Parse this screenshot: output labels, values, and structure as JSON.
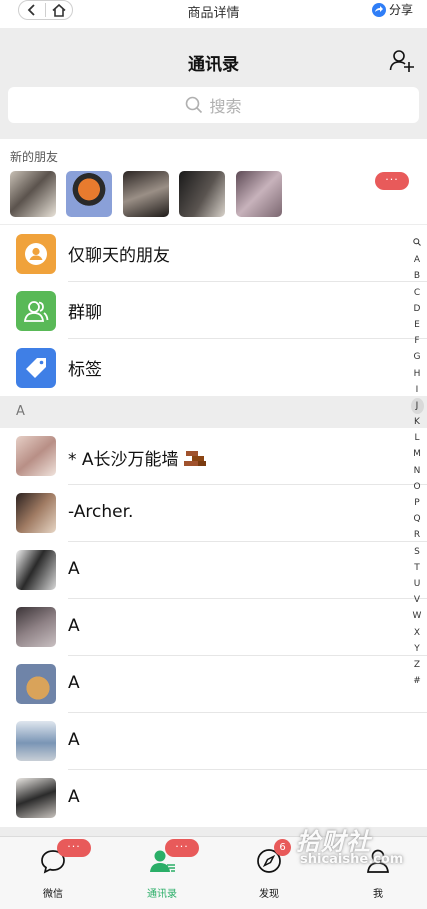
{
  "browser": {
    "title": "商品详情",
    "share_label": "分享"
  },
  "header": {
    "title": "通讯录"
  },
  "search": {
    "placeholder": "搜索"
  },
  "new_friends": {
    "label": "新的朋友",
    "badge": "···"
  },
  "functions": [
    {
      "label": "仅聊天的朋友",
      "color": "#f0a23b"
    },
    {
      "label": "群聊",
      "color": "#59b957"
    },
    {
      "label": "标签",
      "color": "#3f7fe6"
    }
  ],
  "section": {
    "letter": "A"
  },
  "contacts": [
    {
      "name": "*     A长沙万能墙"
    },
    {
      "name": "-Archer."
    },
    {
      "name": "A"
    },
    {
      "name": "A"
    },
    {
      "name": "A"
    },
    {
      "name": "A"
    },
    {
      "name": "A"
    }
  ],
  "alphabet": [
    "A",
    "B",
    "C",
    "D",
    "E",
    "F",
    "G",
    "H",
    "I",
    "J",
    "K",
    "L",
    "M",
    "N",
    "O",
    "P",
    "Q",
    "R",
    "S",
    "T",
    "U",
    "V",
    "W",
    "X",
    "Y",
    "Z",
    "#"
  ],
  "tabs": {
    "chats": {
      "label": "微信",
      "badge": "···"
    },
    "contacts": {
      "label": "通讯录",
      "badge": "···"
    },
    "discover": {
      "label": "发现",
      "badge": "6"
    },
    "me": {
      "label": "我"
    }
  },
  "watermark": {
    "line1": "拾财社",
    "line2": "shicaishe.com"
  },
  "colors": {
    "accent_green": "#2aae67",
    "badge_red": "#e85a5a"
  }
}
